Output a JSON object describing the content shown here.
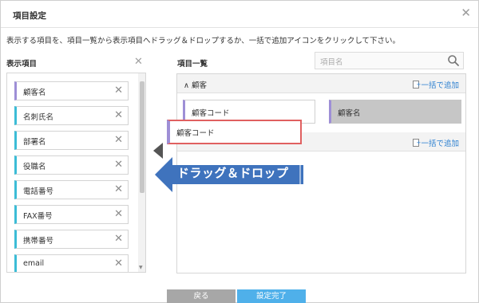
{
  "dialog": {
    "title": "項目設定",
    "instruction": "表示する項目を、項目一覧から表示項目へドラッグ＆ドロップするか、一括で追加アイコンをクリックして下さい。"
  },
  "display_items": {
    "heading": "表示項目",
    "items": [
      {
        "label": "顧客名",
        "color": "#9e8fd6"
      },
      {
        "label": "名刺氏名",
        "color": "#3cbcd6"
      },
      {
        "label": "部署名",
        "color": "#3cbcd6"
      },
      {
        "label": "役職名",
        "color": "#3cbcd6"
      },
      {
        "label": "電話番号",
        "color": "#3cbcd6"
      },
      {
        "label": "FAX番号",
        "color": "#3cbcd6"
      },
      {
        "label": "携帯番号",
        "color": "#3cbcd6"
      },
      {
        "label": "email",
        "color": "#3cbcd6"
      }
    ]
  },
  "item_list": {
    "heading": "項目一覧",
    "search_placeholder": "項目名",
    "groups": [
      {
        "label": "∧ 顧客",
        "add_label": "一括で追加",
        "fields": [
          {
            "label": "顧客コード",
            "selected": false
          },
          {
            "label": "顧客名",
            "selected": true
          }
        ]
      },
      {
        "label": "",
        "add_label": "一括で追加",
        "fields": []
      }
    ]
  },
  "drag": {
    "ghost_label": "顧客コード",
    "callout": "ドラッグ＆ドロップ"
  },
  "buttons": {
    "back": "戻る",
    "done": "設定完了"
  },
  "colors": {
    "accent_blue": "#4fb0ea",
    "callout_blue": "#3f73bd",
    "chip_cyan": "#3cbcd6",
    "chip_purple": "#9e8fd6",
    "highlight_red": "#e06060"
  }
}
